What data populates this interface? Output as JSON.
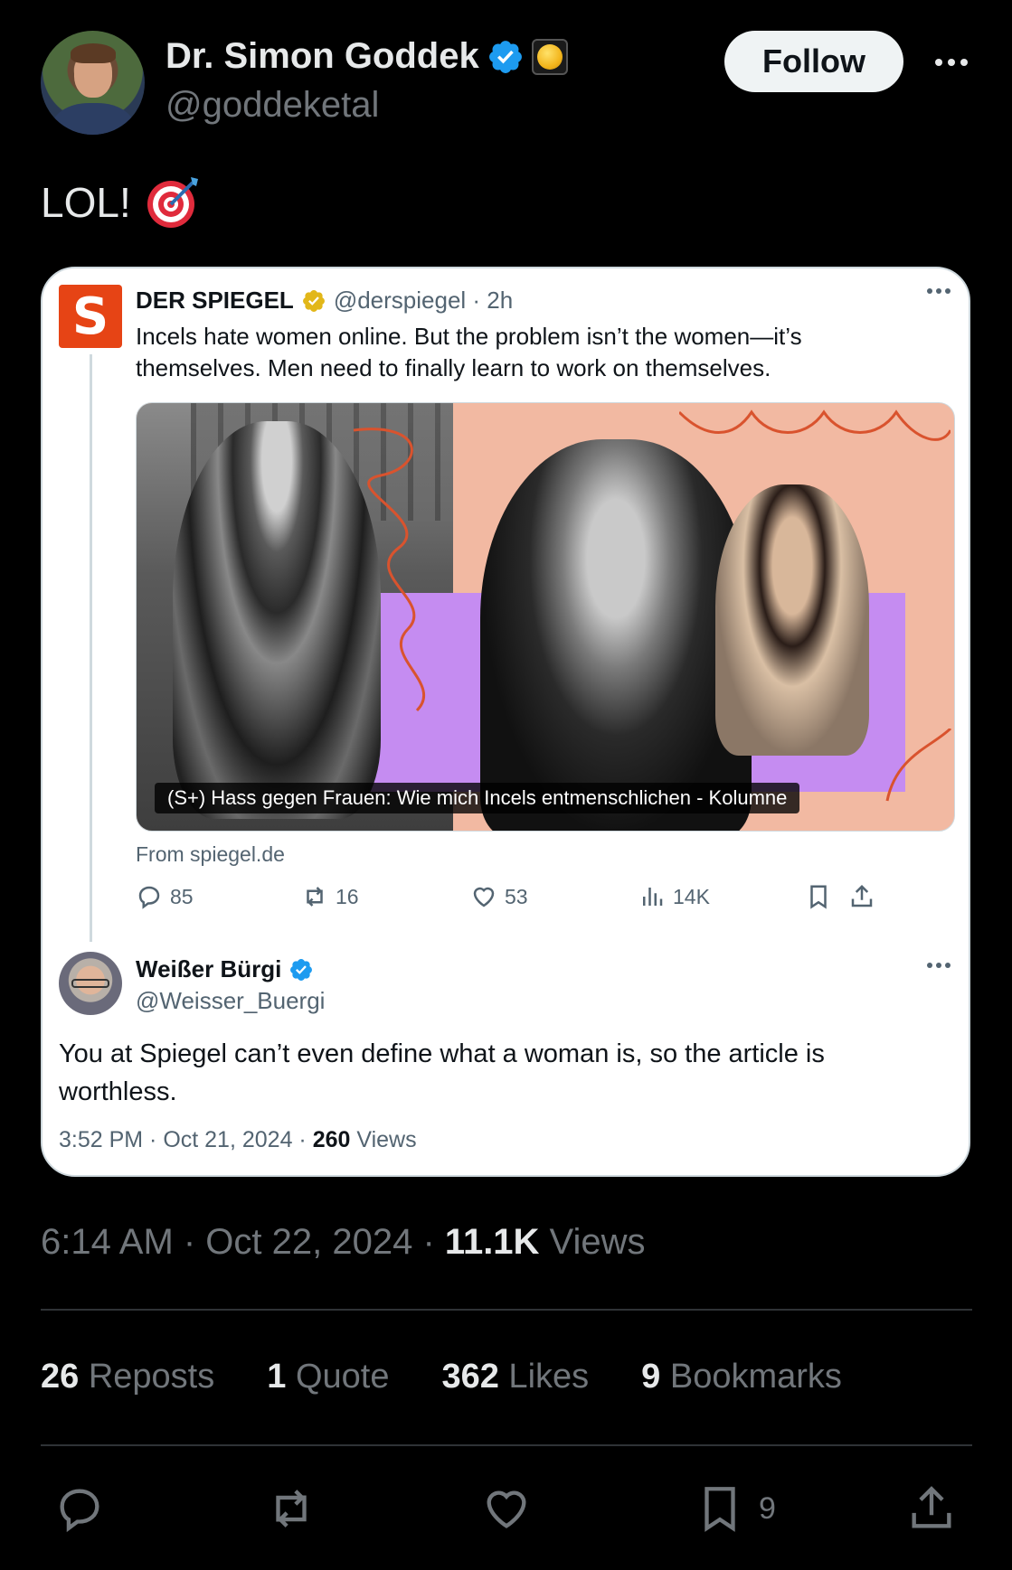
{
  "author": {
    "display_name": "Dr. Simon Goddek",
    "handle": "@goddeketal",
    "follow_label": "Follow"
  },
  "tweet": {
    "text": "LOL!",
    "emoji_icon": "direct-hit-target-icon"
  },
  "quoted": {
    "source_name": "DER SPIEGEL",
    "source_logo_letter": "S",
    "source_meta": "@derspiegel · 2h",
    "text": "Incels hate women online. But the problem isn’t the women—it’s themselves. Men need to finally learn to work on themselves.",
    "media_caption": "(S+) Hass gegen Frauen: Wie mich Incels entmenschlichen - Kolumne",
    "from": "From spiegel.de",
    "actions": {
      "replies": "85",
      "reposts": "16",
      "likes": "53",
      "views": "14K"
    },
    "reply": {
      "name": "Weißer Bürgi",
      "handle": "@Weisser_Buergi",
      "text": "You at Spiegel can’t even define what a woman is, so the article is worthless.",
      "time": "3:52 PM · Oct 21, 2024 · ",
      "views_count": "260",
      "views_label": " Views"
    }
  },
  "timestamp": {
    "time": "6:14 AM · Oct 22, 2024 · ",
    "views_count": "11.1K",
    "views_label": " Views"
  },
  "stats": {
    "reposts_count": "26",
    "reposts_label": " Reposts",
    "quotes_count": "1",
    "quotes_label": " Quote",
    "likes_count": "362",
    "likes_label": " Likes",
    "bookmarks_count": "9",
    "bookmarks_label": " Bookmarks"
  },
  "bottom_actions": {
    "bookmark_count": "9"
  },
  "colors": {
    "verified_blue": "#1d9bf0",
    "gold_badge": "#e2b719",
    "spiegel_red": "#e64415",
    "text_primary": "#e7e9ea",
    "text_secondary": "#71767b"
  }
}
